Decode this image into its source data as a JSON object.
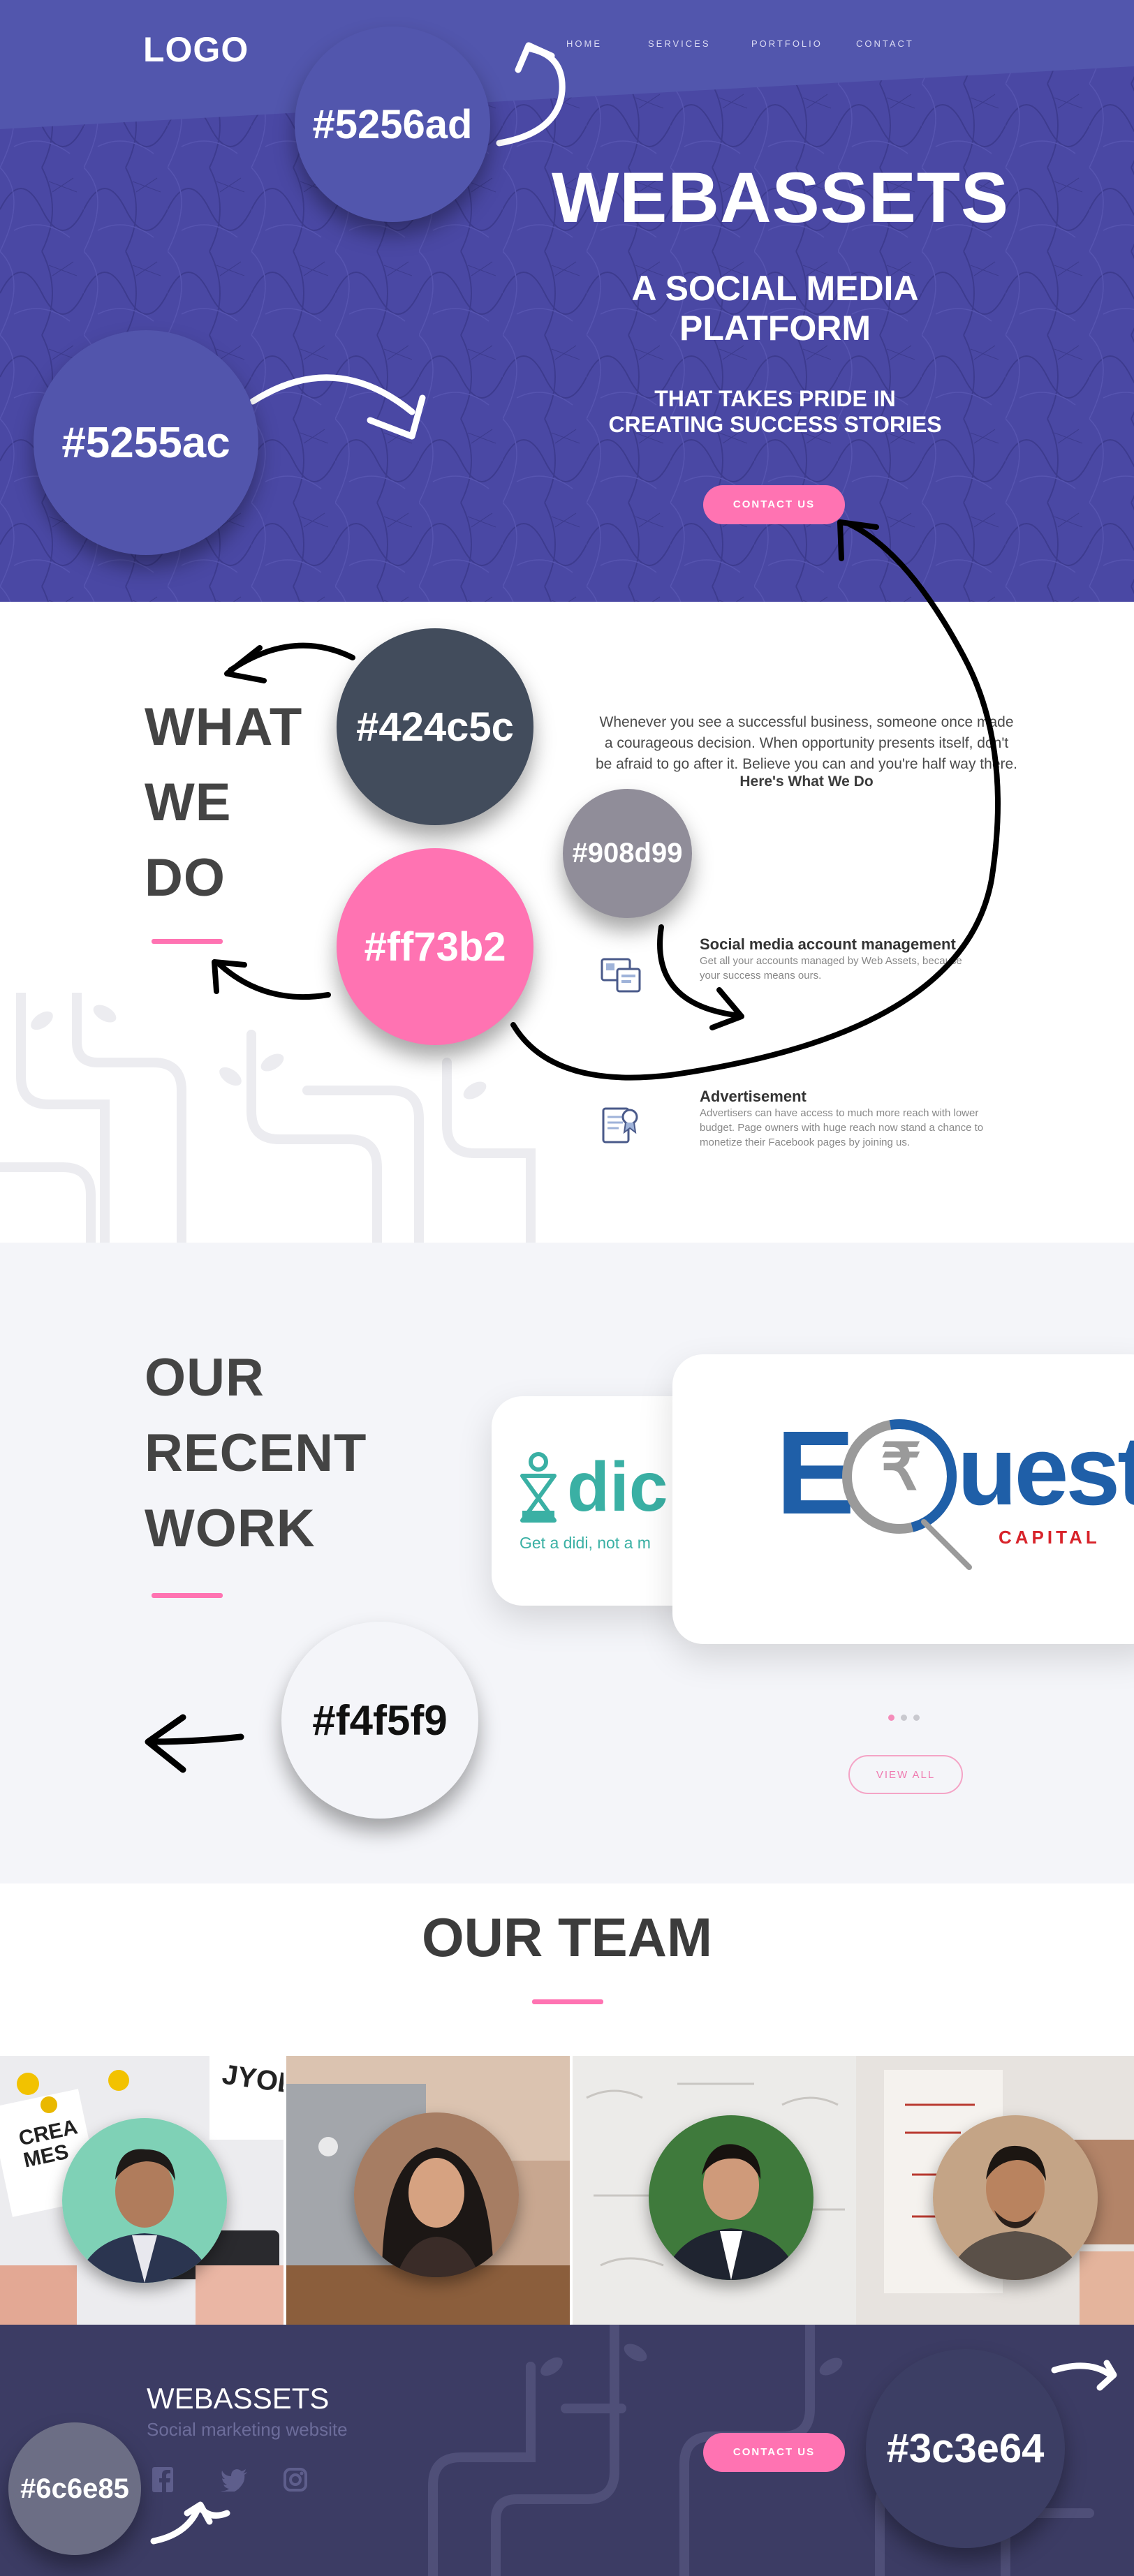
{
  "header": {
    "logo": "LOGO",
    "nav": [
      "HOME",
      "SERVICES",
      "PORTFOLIO",
      "CONTACT"
    ]
  },
  "hero": {
    "title": "WEBASSETS",
    "subtitle_line1": "A SOCIAL MEDIA",
    "subtitle_line2": "PLATFORM",
    "tagline_line1": "THAT TAKES PRIDE IN",
    "tagline_line2": "CREATING SUCCESS STORIES",
    "button": "CONTACT US"
  },
  "swatches": {
    "top": "#5256ad",
    "left": "#5255ac",
    "dark": "#424c5c",
    "grey": "#908d99",
    "pink": "#ff73b2",
    "light": "#f4f5f9",
    "footer_left": "#6c6e85",
    "footer_right": "#3c3e64"
  },
  "what_we_do": {
    "heading_line1": "WHAT",
    "heading_line2": "WE",
    "heading_line3": "DO",
    "intro_line1": "Whenever you see a successful business, someone once made",
    "intro_line2": "a courageous decision. When opportunity presents itself, don't",
    "intro_line3": "be afraid to go after it. Believe you can and you're half way there.",
    "intro_strong": "Here's What We Do",
    "services": [
      {
        "title": "Social media account management",
        "desc_line1": "Get all your accounts managed by Web Assets, because",
        "desc_line2": "your success means ours."
      },
      {
        "title": "Advertisement",
        "desc_line1": "Advertisers can have access to much more reach with lower",
        "desc_line2": "budget. Page owners with huge reach now stand a chance to",
        "desc_line3": "monetize their Facebook pages by joining us."
      }
    ]
  },
  "recent_work": {
    "heading_line1": "OUR",
    "heading_line2": "RECENT",
    "heading_line3": "WORK",
    "didi_logo": "dic",
    "didi_tagline": "Get a didi, not a m",
    "equest_logo_e": "E",
    "equest_logo_rest": "uest",
    "equest_rupee": "₹",
    "equest_capital": "CAPITAL",
    "view_all": "VIEW ALL"
  },
  "team": {
    "heading": "OUR TEAM",
    "photo_sign_text": "JYOB",
    "photo_paper_text": "CREA MES"
  },
  "footer": {
    "title": "WEBASSETS",
    "subtitle": "Social marketing website",
    "button": "CONTACT US",
    "social": [
      "facebook-icon",
      "twitter-icon",
      "instagram-icon"
    ]
  },
  "colors": {
    "hero_bg": "#4a48a4",
    "accent_pink": "#ff73b2",
    "heading_dark": "#444444",
    "section_grey": "#f4f5f9",
    "footer_bg": "#3c3c64",
    "equest_blue": "#1f5fa8",
    "equest_red": "#d8232a",
    "didi_teal": "#3ab0a4"
  }
}
